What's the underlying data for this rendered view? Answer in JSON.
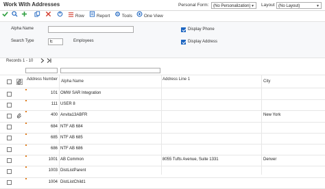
{
  "window": {
    "title": "Work With Addresses",
    "personal_form_label": "Personal Form:",
    "personal_form_value": "(No Personalization)",
    "layout_label": "Layout",
    "layout_value": "(No Layout)"
  },
  "toolbar": {
    "row_label": "Row",
    "report_label": "Report",
    "tools_label": "Tools",
    "one_view_label": "One View"
  },
  "filters": {
    "alpha_name_label": "Alpha Name",
    "alpha_name_value": "",
    "search_type_label": "Search Type",
    "search_type_value": "E",
    "search_type_desc": "Employees",
    "display_phone_label": "Display Phone",
    "display_phone_checked": true,
    "display_address_label": "Display Address",
    "display_address_checked": true
  },
  "grid": {
    "records_label": "Records 1 - 10",
    "columns": {
      "address_number": "Address Number",
      "alpha_name": "Alpha Name",
      "address_line_1": "Address Line 1",
      "city": "City"
    },
    "rows": [
      {
        "address_number": "101",
        "alpha_name": "OMW SAR Integration",
        "address_line_1": "",
        "city": ""
      },
      {
        "address_number": "111",
        "alpha_name": "USER 8",
        "address_line_1": "",
        "city": ""
      },
      {
        "address_number": "400",
        "alpha_name": "Anvita13ABFR",
        "address_line_1": "",
        "city": "New York"
      },
      {
        "address_number": "684",
        "alpha_name": "NTF AB 684",
        "address_line_1": "",
        "city": ""
      },
      {
        "address_number": "685",
        "alpha_name": "NTF AB 685",
        "address_line_1": "",
        "city": ""
      },
      {
        "address_number": "686",
        "alpha_name": "NTF AB 686",
        "address_line_1": "",
        "city": ""
      },
      {
        "address_number": "1001",
        "alpha_name": "AB Common",
        "address_line_1": "8055 Tufts Avenue, Suite 1331",
        "city": "Denver"
      },
      {
        "address_number": "1003",
        "alpha_name": "DistListParent",
        "address_line_1": "",
        "city": ""
      },
      {
        "address_number": "1004",
        "alpha_name": "DistListChild1",
        "address_line_1": "",
        "city": ""
      }
    ]
  },
  "colors": {
    "select_green": "#2e9e3f",
    "add_green": "#2e9e3f",
    "delete_red": "#d23a2a",
    "checkbox_blue": "#1e66c1",
    "row_marker": "#e07b1a"
  }
}
